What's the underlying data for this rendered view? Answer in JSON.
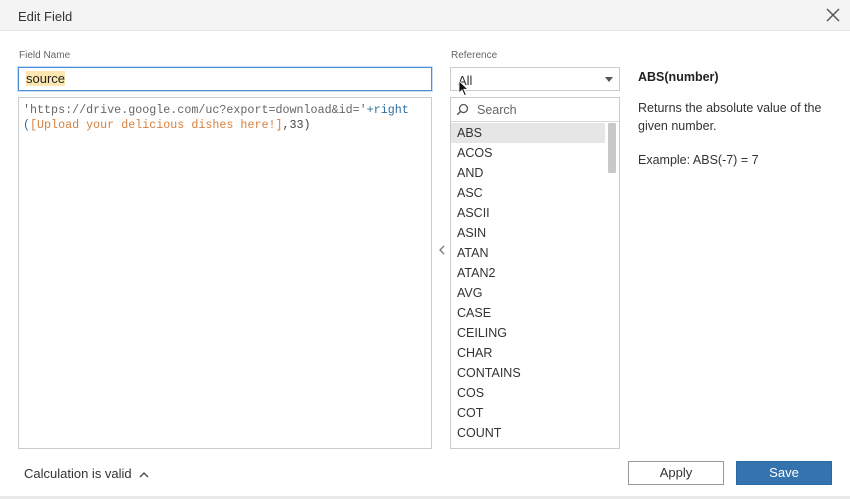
{
  "dialog": {
    "title": "Edit Field"
  },
  "field_name": {
    "label": "Field Name",
    "value": "source"
  },
  "editor": {
    "tokens": [
      {
        "type": "str",
        "text": "'https://drive.google.com/uc?export=download&id='"
      },
      {
        "type": "fn",
        "text": "+right("
      },
      {
        "type": "field",
        "text": "[Upload your delicious dishes here!]"
      },
      {
        "type": "plain",
        "text": ",33)"
      }
    ]
  },
  "reference": {
    "label": "Reference",
    "selected": "All",
    "search_placeholder": "Search",
    "selected_function": "ABS",
    "functions": [
      "ABS",
      "ACOS",
      "AND",
      "ASC",
      "ASCII",
      "ASIN",
      "ATAN",
      "ATAN2",
      "AVG",
      "CASE",
      "CEILING",
      "CHAR",
      "CONTAINS",
      "COS",
      "COT",
      "COUNT"
    ]
  },
  "help": {
    "title": "ABS(number)",
    "description": "Returns the absolute value of the given number.",
    "example": "Example: ABS(-7) = 7"
  },
  "footer": {
    "status": "Calculation is valid",
    "apply_label": "Apply",
    "save_label": "Save"
  },
  "icons": {
    "close": "close-icon",
    "collapse": "chevron-left-icon",
    "dropdown": "caret-down-icon",
    "search": "search-icon",
    "status_toggle": "chevron-up-icon",
    "cursor": "mouse-pointer-icon"
  },
  "colors": {
    "accent": "#3473ad",
    "focus_border": "#4a90d9",
    "field_highlight": "#fde7b0",
    "token_field": "#d6803f",
    "token_function": "#2e6d9e"
  }
}
